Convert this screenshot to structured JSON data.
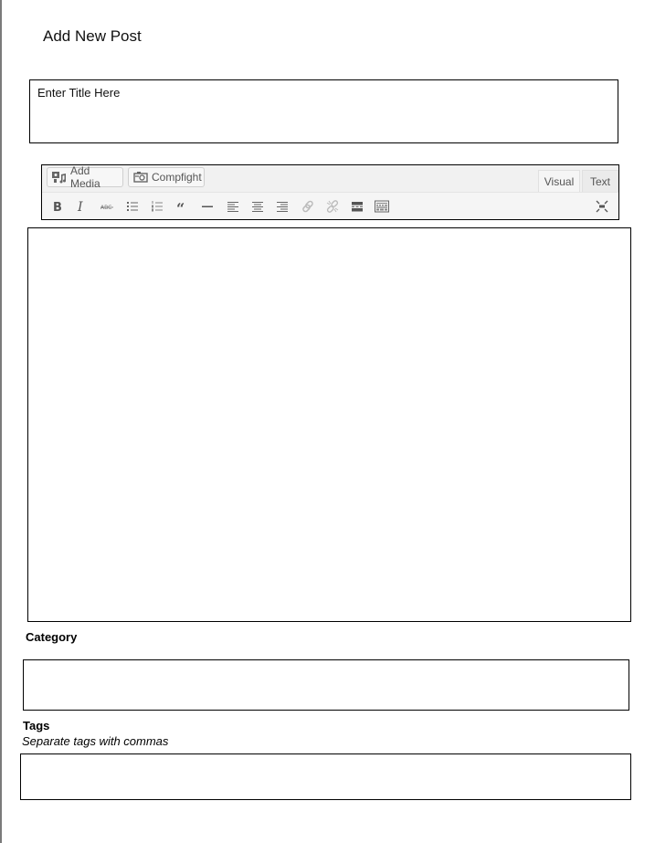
{
  "page": {
    "title": "Add New Post"
  },
  "title_field": {
    "placeholder": "Enter Title Here",
    "value": ""
  },
  "editor": {
    "media_buttons": [
      {
        "label": "Add Media",
        "icon": "add-media-icon"
      },
      {
        "label": "Compfight",
        "icon": "camera-icon"
      }
    ],
    "tabs": [
      {
        "label": "Visual",
        "active": true
      },
      {
        "label": "Text",
        "active": false
      }
    ],
    "format_buttons": [
      {
        "name": "bold",
        "icon": "bold-icon"
      },
      {
        "name": "italic",
        "icon": "italic-icon"
      },
      {
        "name": "strikethrough",
        "icon": "strikethrough-icon"
      },
      {
        "name": "bulleted-list",
        "icon": "bulleted-list-icon"
      },
      {
        "name": "numbered-list",
        "icon": "numbered-list-icon"
      },
      {
        "name": "blockquote",
        "icon": "blockquote-icon"
      },
      {
        "name": "horizontal-line",
        "icon": "horizontal-line-icon"
      },
      {
        "name": "align-left",
        "icon": "align-left-icon"
      },
      {
        "name": "align-center",
        "icon": "align-center-icon"
      },
      {
        "name": "align-right",
        "icon": "align-right-icon"
      },
      {
        "name": "insert-link",
        "icon": "link-icon"
      },
      {
        "name": "remove-link",
        "icon": "unlink-icon"
      },
      {
        "name": "read-more",
        "icon": "read-more-icon"
      },
      {
        "name": "toolbar-toggle",
        "icon": "keyboard-icon"
      },
      {
        "name": "distraction-free",
        "icon": "fullscreen-icon"
      }
    ],
    "content": ""
  },
  "category": {
    "label": "Category",
    "value": ""
  },
  "tags": {
    "label": "Tags",
    "hint": "Separate tags with commas",
    "value": ""
  },
  "colors": {
    "toolbar_bg": "#f1f1f1",
    "icon": "#555555",
    "icon_disabled": "#bbbbbb",
    "border": "#000000"
  }
}
